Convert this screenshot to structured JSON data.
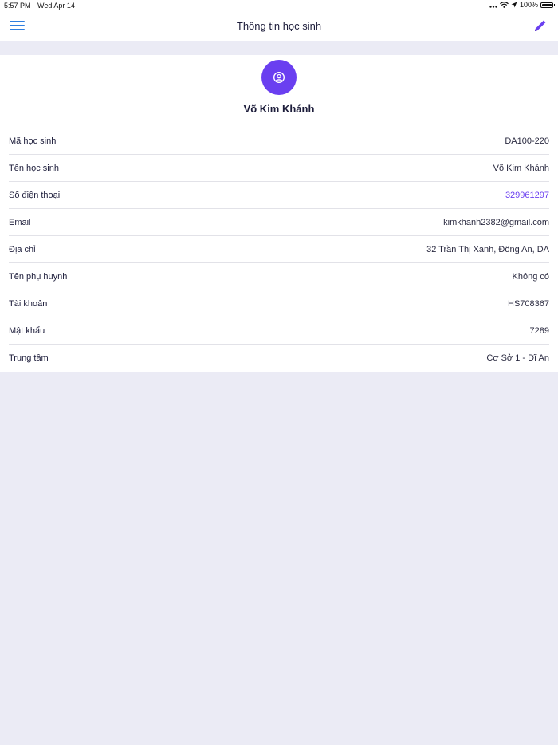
{
  "status_bar": {
    "time": "5:57 PM",
    "date": "Wed Apr 14",
    "battery": "100%",
    "battery_level": 1.0
  },
  "header": {
    "title": "Thông tin học sinh",
    "menu_icon": "hamburger-menu-icon",
    "edit_icon": "pencil-icon"
  },
  "profile": {
    "avatar_icon": "user-circle-icon",
    "name": "Võ Kim Khánh"
  },
  "fields": [
    {
      "label": "Mã học sinh",
      "value": "DA100-220"
    },
    {
      "label": "Tên học sinh",
      "value": "Võ Kim Khánh"
    },
    {
      "label": "Số điện thoại",
      "value": "329961297"
    },
    {
      "label": "Email",
      "value": "kimkhanh2382@gmail.com"
    },
    {
      "label": "Địa chỉ",
      "value": "32 Trần Thị Xanh, Đông An, DA"
    },
    {
      "label": "Tên phụ huynh",
      "value": "Không có"
    },
    {
      "label": "Tài khoản",
      "value": "HS708367"
    },
    {
      "label": "Mật khẩu",
      "value": "7289"
    },
    {
      "label": "Trung tâm",
      "value": "Cơ Sở 1 - Dĩ An"
    }
  ],
  "colors": {
    "accent": "#6a3ff0",
    "menu_blue": "#2f7fe0",
    "background": "#ebebf5",
    "text": "#1c1c3a"
  }
}
